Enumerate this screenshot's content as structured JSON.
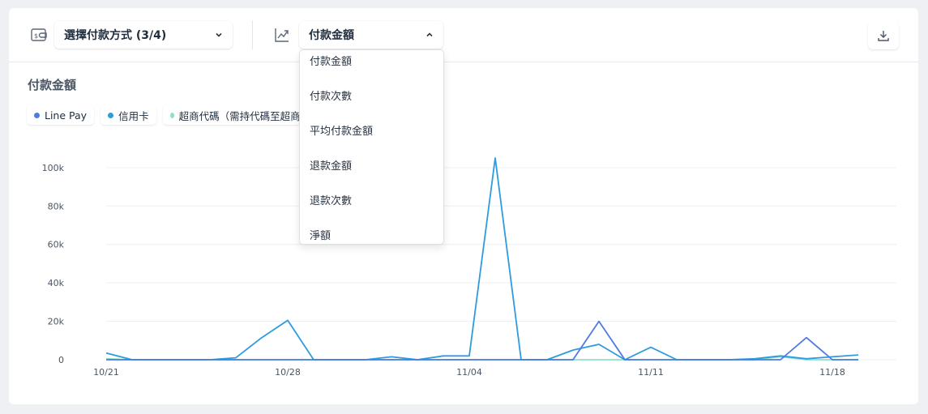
{
  "toolbar": {
    "payment_select_label": "選擇付款方式 (3/4)",
    "metric_select_label": "付款金額"
  },
  "metric_menu": {
    "items": [
      "付款金額",
      "付款次數",
      "平均付款金額",
      "退款金額",
      "退款次數",
      "淨額"
    ]
  },
  "section_title": "付款金額",
  "legend": [
    {
      "label": "Line Pay",
      "color": "#4f7be0"
    },
    {
      "label": "信用卡",
      "color": "#2d9be0"
    },
    {
      "label": "超商代碼（需持代碼至超商",
      "color": "#8fe0c6"
    }
  ],
  "chart_data": {
    "type": "line",
    "x": [
      "10/21",
      "10/22",
      "10/23",
      "10/24",
      "10/25",
      "10/26",
      "10/27",
      "10/28",
      "10/29",
      "10/30",
      "10/31",
      "11/01",
      "11/02",
      "11/03",
      "11/04",
      "11/05",
      "11/06",
      "11/07",
      "11/08",
      "11/09",
      "11/10",
      "11/11",
      "11/12",
      "11/13",
      "11/14",
      "11/15",
      "11/16",
      "11/17",
      "11/18",
      "11/19"
    ],
    "x_tick_labels": [
      "10/21",
      "10/28",
      "11/04",
      "11/11",
      "11/18"
    ],
    "y_tick_labels": [
      "0",
      "20k",
      "40k",
      "60k",
      "80k",
      "100k"
    ],
    "ylim": [
      0,
      105000
    ],
    "grid": true,
    "series": [
      {
        "name": "Line Pay",
        "color": "#4f7be0",
        "values": [
          0,
          0,
          0,
          0,
          0,
          0,
          0,
          0,
          0,
          0,
          0,
          0,
          0,
          0,
          0,
          0,
          0,
          0,
          0,
          20000,
          0,
          0,
          0,
          0,
          0,
          0,
          0,
          11500,
          0,
          0
        ]
      },
      {
        "name": "信用卡",
        "color": "#2d9be0",
        "values": [
          3500,
          0,
          0,
          0,
          0,
          1000,
          11500,
          20500,
          0,
          0,
          0,
          1500,
          0,
          2000,
          2000,
          105000,
          0,
          0,
          5000,
          8000,
          0,
          6500,
          0,
          0,
          0,
          500,
          2000,
          500,
          1500,
          2500
        ]
      },
      {
        "name": "超商代碼（需持代碼至超商",
        "color": "#8fe0c6",
        "values": [
          500,
          0,
          0,
          0,
          0,
          0,
          0,
          0,
          0,
          0,
          0,
          0,
          0,
          0,
          0,
          0,
          0,
          0,
          0,
          0,
          0,
          0,
          0,
          0,
          0,
          0,
          1500,
          0,
          0,
          0
        ]
      }
    ]
  }
}
